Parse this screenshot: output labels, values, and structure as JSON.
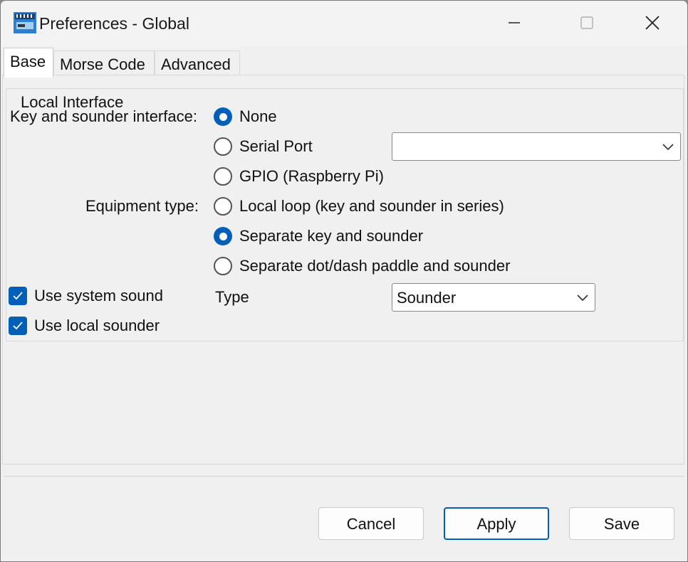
{
  "window": {
    "title": "Preferences - Global"
  },
  "tabs": [
    {
      "label": "Base",
      "active": true
    },
    {
      "label": "Morse Code",
      "active": false
    },
    {
      "label": "Advanced",
      "active": false
    }
  ],
  "local_interface": {
    "group_title": "Local Interface",
    "key_sounder_label": "Key and sounder interface:",
    "interface_options": [
      {
        "label": "None",
        "checked": true
      },
      {
        "label": "Serial Port",
        "checked": false
      },
      {
        "label": "GPIO (Raspberry Pi)",
        "checked": false
      }
    ],
    "serial_port_value": "",
    "equipment_label": "Equipment type:",
    "equipment_options": [
      {
        "label": "Local loop (key and sounder in series)",
        "checked": false
      },
      {
        "label": "Separate key and sounder",
        "checked": true
      },
      {
        "label": "Separate dot/dash paddle and sounder",
        "checked": false
      }
    ],
    "use_system_sound": {
      "label": "Use system sound",
      "checked": true
    },
    "use_local_sounder": {
      "label": "Use local sounder",
      "checked": true
    },
    "type_label": "Type",
    "type_value": "Sounder"
  },
  "buttons": {
    "cancel": "Cancel",
    "apply": "Apply",
    "save": "Save"
  },
  "colors": {
    "accent": "#005fb8"
  },
  "icons": {
    "app": "app-icon",
    "minimize": "minimize-icon",
    "maximize": "maximize-icon",
    "close": "close-icon",
    "dropdown": "chevron-down-icon",
    "check": "checkmark-icon"
  }
}
